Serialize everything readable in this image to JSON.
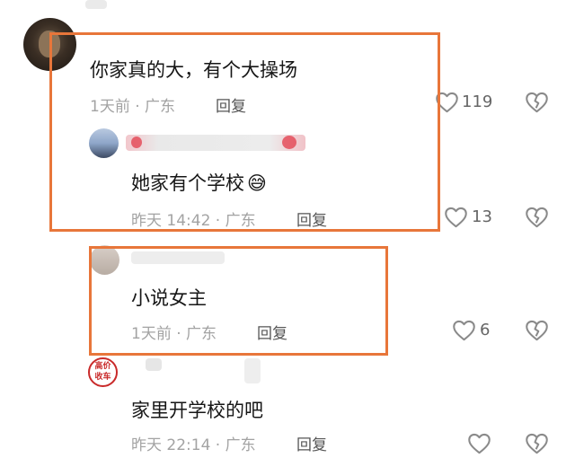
{
  "comments": [
    {
      "text": "你家真的大，有个大操场",
      "meta": "1天前 · 广东",
      "reply_label": "回复",
      "likes": "119"
    },
    {
      "text": "她家有个学校",
      "emoji": "😅",
      "meta": "昨天 14:42 · 广东",
      "reply_label": "回复",
      "likes": "13"
    },
    {
      "text": "小说女主",
      "meta": "1天前 · 广东",
      "reply_label": "回复",
      "likes": "6"
    },
    {
      "text": "家里开学校的吧",
      "meta": "昨天 22:14 · 广东",
      "reply_label": "回复"
    }
  ],
  "badge": {
    "line1": "高价",
    "line2": "收车"
  },
  "colors": {
    "highlight": "#e8763a",
    "icon": "#8a8a8a",
    "username_red": "#e33b4a"
  },
  "icons": {
    "like": "heart-outline-icon",
    "dislike": "broken-heart-icon"
  }
}
